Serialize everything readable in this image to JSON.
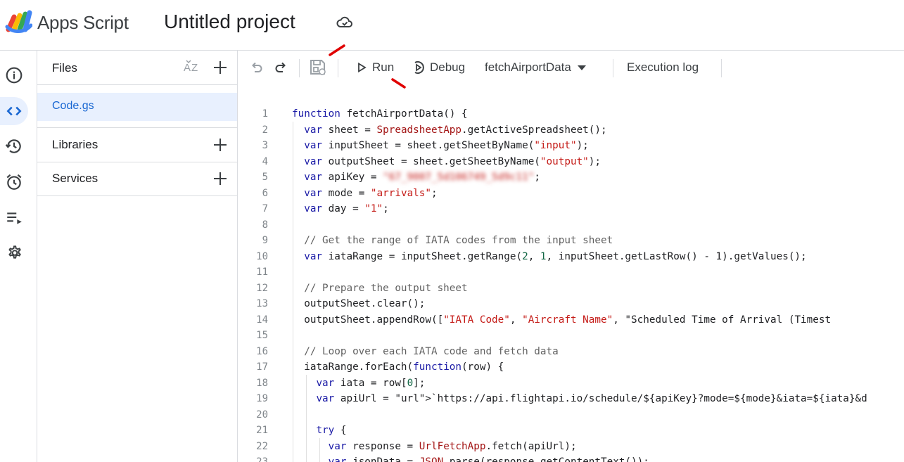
{
  "header": {
    "app_name": "Apps Script",
    "project_name": "Untitled project"
  },
  "files_panel": {
    "title": "Files",
    "files": [
      {
        "name": "Code.gs"
      }
    ],
    "sections": [
      {
        "label": "Libraries"
      },
      {
        "label": "Services"
      }
    ]
  },
  "toolbar": {
    "run_label": "Run",
    "debug_label": "Debug",
    "function_selected": "fetchAirportData",
    "execution_log_label": "Execution log"
  },
  "editor": {
    "line_numbers": [
      "1",
      "2",
      "3",
      "4",
      "5",
      "6",
      "7",
      "8",
      "9",
      "10",
      "11",
      "12",
      "13",
      "14",
      "15",
      "16",
      "17",
      "18",
      "19",
      "20",
      "21",
      "22",
      "23"
    ],
    "lines": [
      "function fetchAirportData() {",
      "  var sheet = SpreadsheetApp.getActiveSpreadsheet();",
      "  var inputSheet = sheet.getSheetByName(\"input\");",
      "  var outputSheet = sheet.getSheetByName(\"output\");",
      "  var apiKey = \"67_9007_5d106749_5d9c11\";",
      "  var mode = \"arrivals\";",
      "  var day = \"1\";",
      "",
      "  // Get the range of IATA codes from the input sheet",
      "  var iataRange = inputSheet.getRange(2, 1, inputSheet.getLastRow() - 1).getValues();",
      "",
      "  // Prepare the output sheet",
      "  outputSheet.clear();",
      "  outputSheet.appendRow([\"IATA Code\", \"Aircraft Name\", \"Scheduled Time of Arrival (Timest",
      "",
      "  // Loop over each IATA code and fetch data",
      "  iataRange.forEach(function(row) {",
      "    var iata = row[0];",
      "    var apiUrl = `https://api.flightapi.io/schedule/${apiKey}?mode=${mode}&iata=${iata}&d",
      "",
      "    try {",
      "      var response = UrlFetchApp.fetch(apiUrl);",
      "      var jsonData = JSON.parse(response.getContentText());"
    ]
  },
  "colors": {
    "keyword": "#1a1aa6",
    "string": "#c41a16",
    "comment": "#616161",
    "accent": "#1967d2",
    "annotation_arrow": "#e00000"
  }
}
